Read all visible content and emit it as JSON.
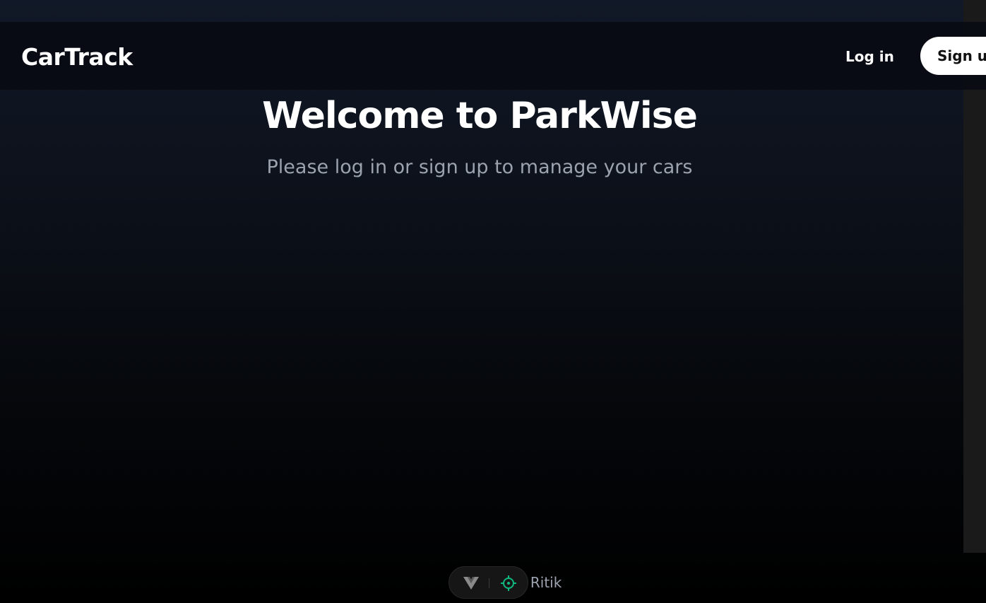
{
  "navbar": {
    "brand": "CarTrack",
    "login_label": "Log in",
    "signup_label": "Sign up"
  },
  "hero": {
    "title": "Welcome to ParkWise",
    "subtitle": "Please log in or sign up to manage your cars"
  },
  "footer": {
    "text": "by Ritik"
  },
  "devtools": {
    "icons": [
      "vue-logo-icon",
      "target-icon"
    ]
  },
  "colors": {
    "background_top": "#111827",
    "background_bottom": "#000000",
    "subtitle": "#9ca3af",
    "signup_bg": "#ffffff",
    "devtools_accent": "#10b981"
  }
}
